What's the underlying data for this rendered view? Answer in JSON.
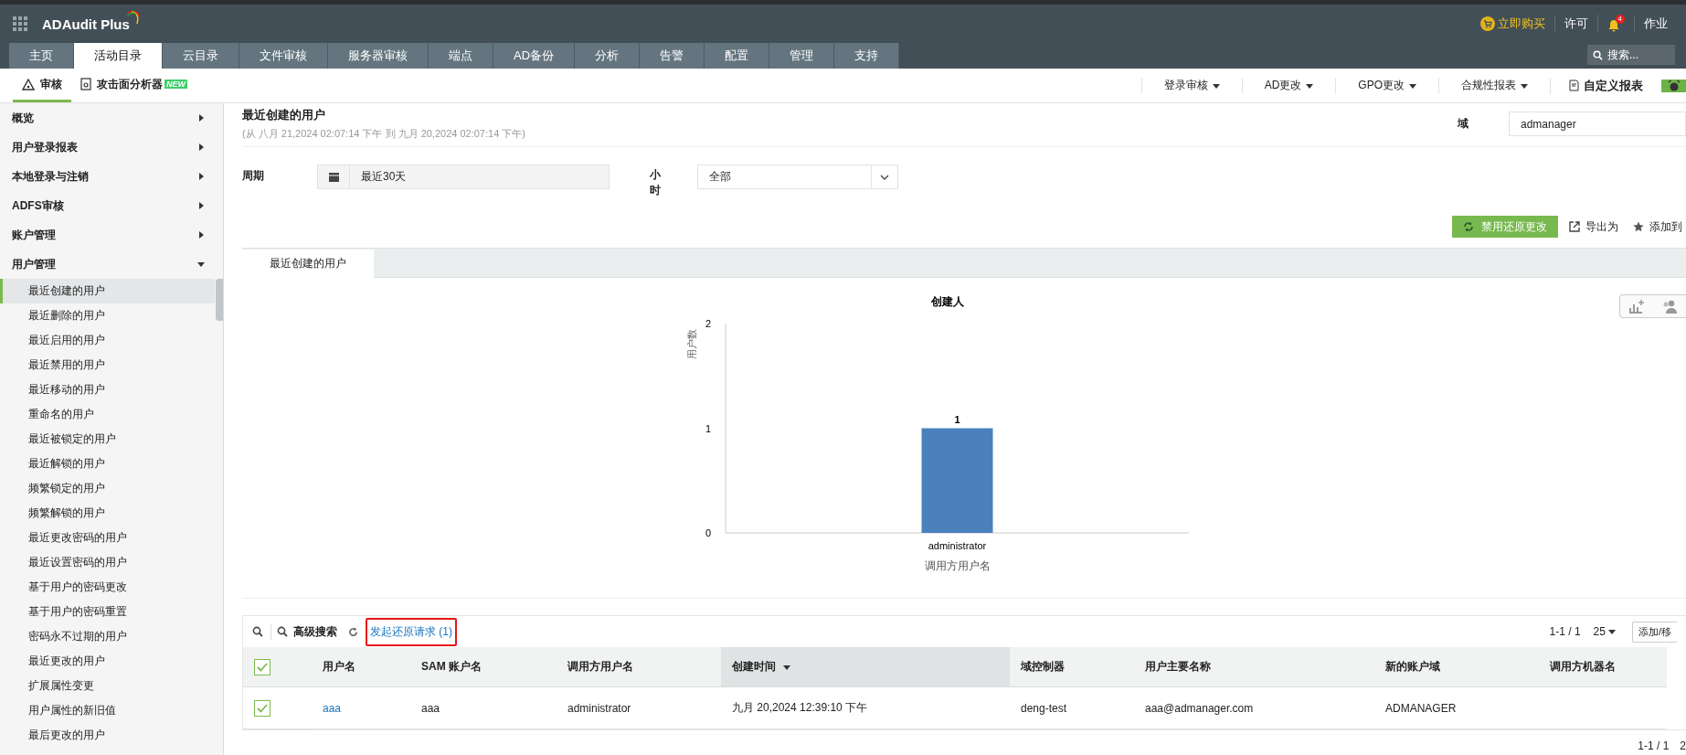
{
  "header": {
    "product": "ADAudit Plus",
    "links": [
      {
        "kind": "buy",
        "label": "立即购买"
      },
      {
        "kind": "text",
        "label": "许可"
      },
      {
        "kind": "bell",
        "badge": "4"
      },
      {
        "kind": "text",
        "label": "作业"
      }
    ],
    "search": {
      "placeholder": "搜索..."
    }
  },
  "nav_tabs": [
    {
      "label": "主页",
      "selected": false
    },
    {
      "label": "活动目录",
      "selected": true
    },
    {
      "label": "云目录",
      "selected": false
    },
    {
      "label": "文件审核",
      "selected": false
    },
    {
      "label": "服务器审核",
      "selected": false
    },
    {
      "label": "端点",
      "selected": false
    },
    {
      "label": "AD备份",
      "selected": false
    },
    {
      "label": "分析",
      "selected": false
    },
    {
      "label": "告警",
      "selected": false
    },
    {
      "label": "配置",
      "selected": false
    },
    {
      "label": "管理",
      "selected": false
    },
    {
      "label": "支持",
      "selected": false
    }
  ],
  "subnav": {
    "items": [
      {
        "kind": "audit",
        "label": "审核",
        "selected": true
      },
      {
        "kind": "analyzer",
        "label": "攻击面分析器",
        "badge": "NEW",
        "selected": false
      }
    ],
    "menus": [
      "登录审核",
      "AD更改",
      "GPO更改",
      "合规性报表"
    ],
    "custom_report": "自定义报表"
  },
  "sidebar": {
    "groups": [
      {
        "label": "概览",
        "expanded": false
      },
      {
        "label": "用户登录报表",
        "expanded": false
      },
      {
        "label": "本地登录与注销",
        "expanded": false
      },
      {
        "label": "ADFS审核",
        "expanded": false
      },
      {
        "label": "账户管理",
        "expanded": false
      },
      {
        "label": "用户管理",
        "expanded": true,
        "children": [
          {
            "label": "最近创建的用户",
            "selected": true
          },
          {
            "label": "最近删除的用户",
            "selected": false
          },
          {
            "label": "最近启用的用户",
            "selected": false
          },
          {
            "label": "最近禁用的用户",
            "selected": false
          },
          {
            "label": "最近移动的用户",
            "selected": false
          },
          {
            "label": "重命名的用户",
            "selected": false
          },
          {
            "label": "最近被锁定的用户",
            "selected": false
          },
          {
            "label": "最近解锁的用户",
            "selected": false
          },
          {
            "label": "频繁锁定的用户",
            "selected": false
          },
          {
            "label": "频繁解锁的用户",
            "selected": false
          },
          {
            "label": "最近更改密码的用户",
            "selected": false
          },
          {
            "label": "最近设置密码的用户",
            "selected": false
          },
          {
            "label": "基于用户的密码更改",
            "selected": false
          },
          {
            "label": "基于用户的密码重置",
            "selected": false
          },
          {
            "label": "密码永不过期的用户",
            "selected": false
          },
          {
            "label": "最近更改的用户",
            "selected": false
          },
          {
            "label": "扩展属性变更",
            "selected": false
          },
          {
            "label": "用户属性的新旧值",
            "selected": false
          },
          {
            "label": "最后更改的用户",
            "selected": false
          }
        ]
      }
    ]
  },
  "report": {
    "title": "最近创建的用户",
    "range": "(从 八月 21,2024 02:07:14 下午 到 九月 20,2024 02:07:14 下午)",
    "domain_label": "域",
    "domain_value": "admanager",
    "period_label": "周期",
    "period_value": "最近30天",
    "hour_label": "小时",
    "hour_value": "全部",
    "actions": {
      "restore": "禁用还原更改",
      "export": "导出为",
      "add": "添加到"
    },
    "tabs": [
      {
        "label": "最近创建的用户",
        "selected": true
      }
    ],
    "chart_data": {
      "type": "bar",
      "title": "创建人",
      "xlabel": "调用方用户名",
      "ylabel": "用户数",
      "categories": [
        "administrator"
      ],
      "values": [
        1
      ],
      "ylim": [
        0,
        2
      ],
      "yticks": [
        0,
        1,
        2
      ],
      "data_labels": true
    }
  },
  "table": {
    "toolbar": {
      "advanced_search": "高级搜索",
      "restore_request": "发起还原请求 (1)",
      "highlighted": true
    },
    "pager": "1-1 / 1",
    "page_size": "25",
    "add_remove": "添加/移",
    "all_checked": true,
    "columns": [
      {
        "label": "用户名",
        "kind": "link",
        "sorted": false
      },
      {
        "label": "SAM 账户名",
        "kind": "text",
        "sorted": false
      },
      {
        "label": "调用方用户名",
        "kind": "text",
        "sorted": false
      },
      {
        "label": "创建时间",
        "kind": "text",
        "sorted": true
      },
      {
        "label": "域控制器",
        "kind": "text",
        "sorted": false
      },
      {
        "label": "用户主要名称",
        "kind": "text",
        "sorted": false
      },
      {
        "label": "新的账户域",
        "kind": "text",
        "sorted": false
      },
      {
        "label": "调用方机器名",
        "kind": "text",
        "sorted": false
      }
    ],
    "rows": [
      {
        "checked": true,
        "cells": [
          "aaa",
          "aaa",
          "administrator",
          "九月 20,2024 12:39:10 下午",
          "deng-test",
          "aaa@admanager.com",
          "ADMANAGER"
        ]
      }
    ],
    "bottom_pager": "1-1 / 1",
    "bottom_page_size": "2"
  }
}
